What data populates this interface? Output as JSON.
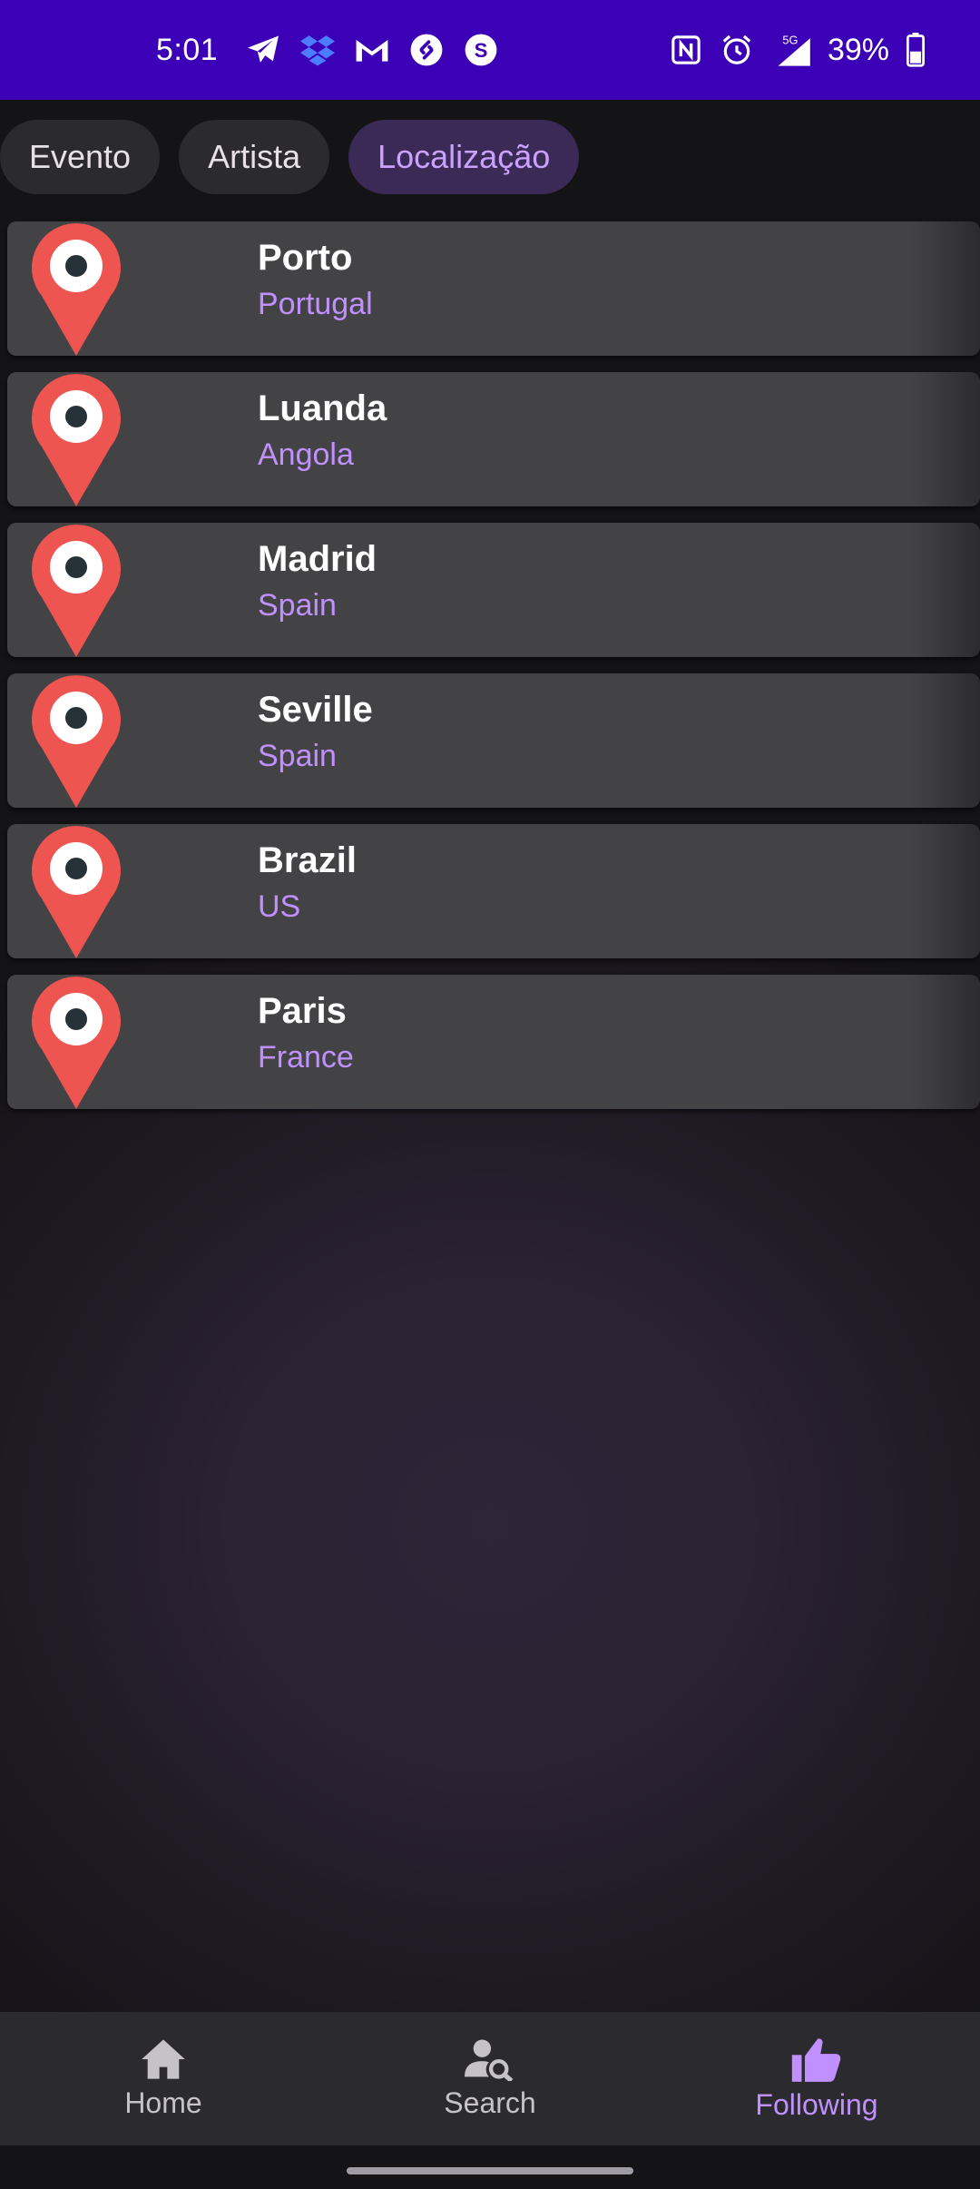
{
  "status_bar": {
    "time": "5:01",
    "battery_percent": "39%",
    "network": "5G",
    "icons": [
      "telegram-icon",
      "dropbox-icon",
      "gmail-icon",
      "shazam-icon",
      "s-app-icon",
      "nfc-icon",
      "alarm-icon",
      "signal-icon",
      "battery-icon"
    ]
  },
  "tabs": [
    {
      "label": "Evento",
      "active": false
    },
    {
      "label": "Artista",
      "active": false
    },
    {
      "label": "Localização",
      "active": true
    }
  ],
  "locations": [
    {
      "name": "Porto",
      "country": "Portugal"
    },
    {
      "name": "Luanda",
      "country": "Angola"
    },
    {
      "name": "Madrid",
      "country": "Spain"
    },
    {
      "name": "Seville",
      "country": "Spain"
    },
    {
      "name": "Brazil",
      "country": "US"
    },
    {
      "name": "Paris",
      "country": "France"
    }
  ],
  "bottom_nav": [
    {
      "label": "Home",
      "icon": "home-icon",
      "active": false
    },
    {
      "label": "Search",
      "icon": "person-search-icon",
      "active": false
    },
    {
      "label": "Following",
      "icon": "thumbs-up-icon",
      "active": true
    }
  ],
  "colors": {
    "status_bar": "#3c00b6",
    "accent": "#c190ff",
    "pin": "#ee5450",
    "card": "#434244"
  }
}
